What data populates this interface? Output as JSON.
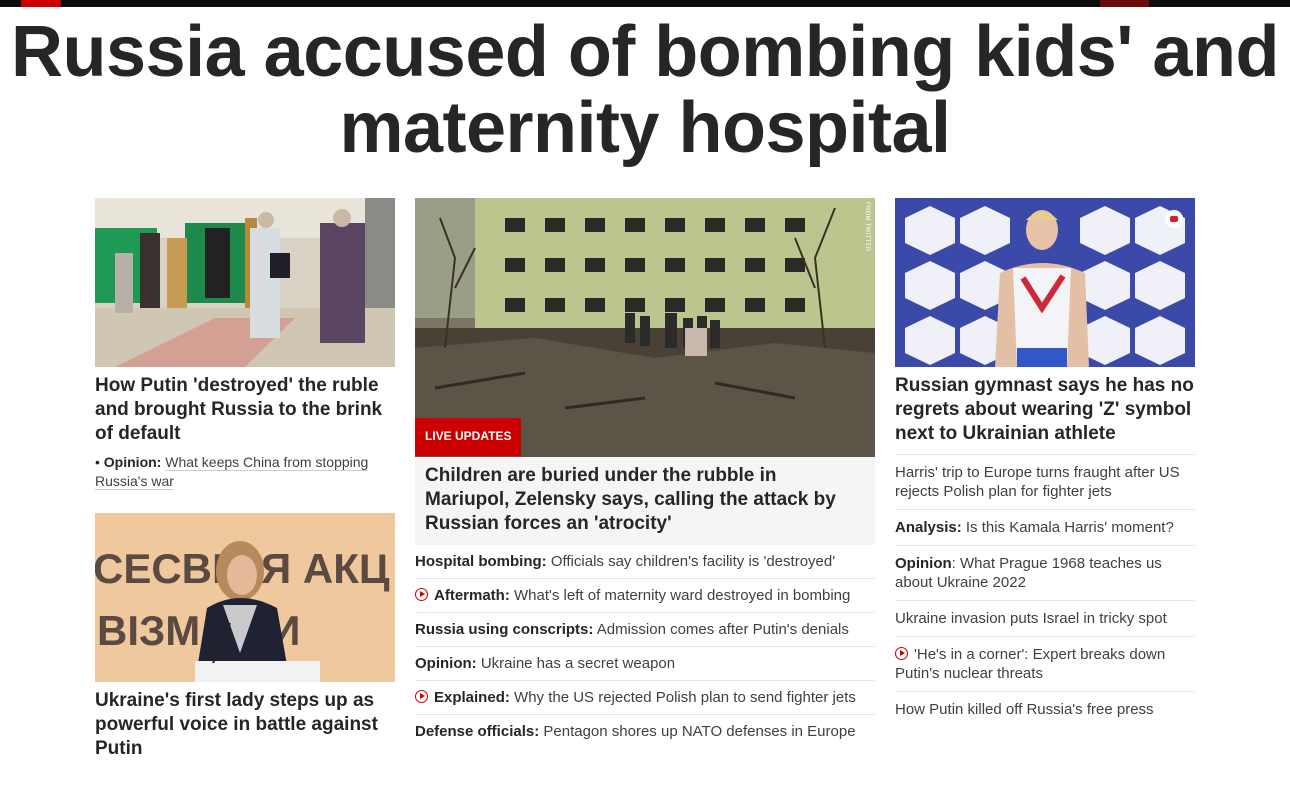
{
  "headline": "Russia accused of bombing kids' and maternity hospital",
  "left": {
    "story1": {
      "image_alt": "People waiting at ATMs in Russia",
      "title": "How Putin 'destroyed' the ruble and brought Russia to the brink of default",
      "opinion": {
        "bullet": "•",
        "kicker": "Opinion:",
        "text": "What keeps China from stopping Russia's war"
      }
    },
    "story2": {
      "image_alt": "Olena Zelenska speaking at a podium",
      "image_text_line1": "СЕСВІТ   Я  АКЦ",
      "image_text_line2": "ВІЗМ        ОТИ",
      "title": "Ukraine's first lady steps up as powerful voice in battle against Putin"
    }
  },
  "middle": {
    "image_alt": "Destroyed maternity hospital in Mariupol",
    "credit": "FROM TWITTER",
    "badge": "LIVE UPDATES",
    "title": "Children are buried under the rubble in Mariupol, Zelensky says, calling the attack by Russian forces an 'atrocity'",
    "items": [
      {
        "kicker": "Hospital bombing:",
        "text": "Officials say children's facility is 'destroyed'",
        "video": false
      },
      {
        "kicker": "Aftermath:",
        "text": "What's left of maternity ward destroyed in bombing",
        "video": true
      },
      {
        "kicker": "Russia using conscripts:",
        "text": "Admission comes after Putin's denials",
        "video": false
      },
      {
        "kicker": "Opinion:",
        "text": "Ukraine has a secret weapon",
        "video": false
      },
      {
        "kicker": "Explained:",
        "text": "Why the US rejected Polish plan to send fighter jets",
        "video": true
      },
      {
        "kicker": "Defense officials:",
        "text": "Pentagon shores up NATO defenses in Europe",
        "video": false
      }
    ]
  },
  "right": {
    "image_alt": "Russian gymnast wearing Z symbol on podium",
    "title": "Russian gymnast says he has no regrets about wearing 'Z' symbol next to Ukrainian athlete",
    "items": [
      {
        "kicker": "",
        "text": "Harris' trip to Europe turns fraught after US rejects Polish plan for fighter jets",
        "video": false
      },
      {
        "kicker": "Analysis:",
        "text": "Is this Kamala Harris' moment?",
        "video": false
      },
      {
        "kicker": "Opinion",
        "text": ": What Prague 1968 teaches us about Ukraine 2022",
        "video": false
      },
      {
        "kicker": "",
        "text": "Ukraine invasion puts Israel in tricky spot",
        "video": false
      },
      {
        "kicker": "",
        "text": "'He's in a corner': Expert breaks down Putin's nuclear threats",
        "video": true
      },
      {
        "kicker": "",
        "text": "How Putin killed off Russia's free press",
        "video": false
      }
    ]
  },
  "colors": {
    "accent": "#cc0000",
    "text": "#262626",
    "divider": "#e6e6e6"
  }
}
